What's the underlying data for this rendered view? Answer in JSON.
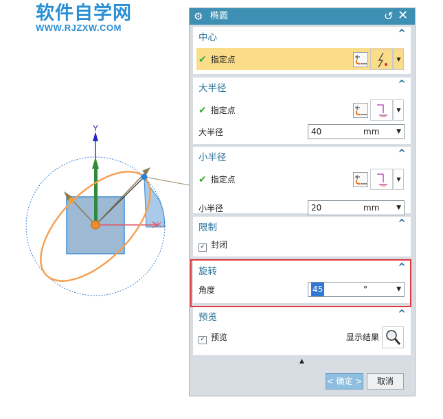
{
  "watermark": {
    "title": "软件自学网",
    "url": "WWW.RJZXW.COM"
  },
  "scene": {
    "axis_y_label": "Y",
    "axis_x_label": "X"
  },
  "dialog": {
    "title": "椭圆",
    "title_icon": "gear-icon",
    "groups": {
      "center": {
        "title": "中心",
        "point_label": "指定点"
      },
      "major": {
        "title": "大半径",
        "point_label": "指定点",
        "field_label": "大半径",
        "value": "40",
        "unit": "mm"
      },
      "minor": {
        "title": "小半径",
        "point_label": "指定点",
        "field_label": "小半径",
        "value": "20",
        "unit": "mm"
      },
      "limit": {
        "title": "限制",
        "checkbox_label": "封闭",
        "checked": true
      },
      "rotate": {
        "title": "旋转",
        "field_label": "角度",
        "value": "45",
        "unit": "°"
      },
      "preview": {
        "title": "预览",
        "checkbox_label": "预览",
        "checked": true,
        "show_result_label": "显示结果"
      }
    },
    "buttons": {
      "ok": "< 确定 >",
      "cancel": "取消"
    }
  },
  "colors": {
    "title_bar": "#3d8fb3",
    "highlight": "#fbdc88",
    "annotation": "#e0383d",
    "ellipse": "#f5a055"
  }
}
